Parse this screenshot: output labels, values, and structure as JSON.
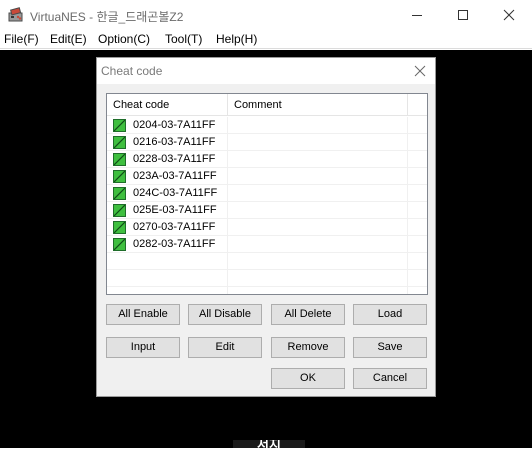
{
  "window": {
    "title": "VirtuaNES - 한글_드래곤볼Z2",
    "icon": "virtuanes-app-icon",
    "controls": [
      "minimize-icon",
      "maximize-icon",
      "close-icon"
    ]
  },
  "menu": {
    "items": [
      "File(F)",
      "Edit(E)",
      "Option(C)",
      "Tool(T)",
      "Help(H)"
    ]
  },
  "game_screen": {
    "glyph": "서지"
  },
  "dialog": {
    "title": "Cheat code",
    "columns": [
      "Cheat code",
      "Comment"
    ],
    "rows": [
      {
        "code": "0204-03-7A11FF",
        "comment": "",
        "enabled": true
      },
      {
        "code": "0216-03-7A11FF",
        "comment": "",
        "enabled": true
      },
      {
        "code": "0228-03-7A11FF",
        "comment": "",
        "enabled": true
      },
      {
        "code": "023A-03-7A11FF",
        "comment": "",
        "enabled": true
      },
      {
        "code": "024C-03-7A11FF",
        "comment": "",
        "enabled": true
      },
      {
        "code": "025E-03-7A11FF",
        "comment": "",
        "enabled": true
      },
      {
        "code": "0270-03-7A11FF",
        "comment": "",
        "enabled": true
      },
      {
        "code": "0282-03-7A11FF",
        "comment": "",
        "enabled": true
      }
    ],
    "buttons": {
      "all_enable": "All Enable",
      "all_disable": "All Disable",
      "all_delete": "All Delete",
      "load": "Load",
      "input": "Input",
      "edit": "Edit",
      "remove": "Remove",
      "save": "Save",
      "ok": "OK",
      "cancel": "Cancel"
    },
    "checkbox_color": "#3fbf3f"
  }
}
